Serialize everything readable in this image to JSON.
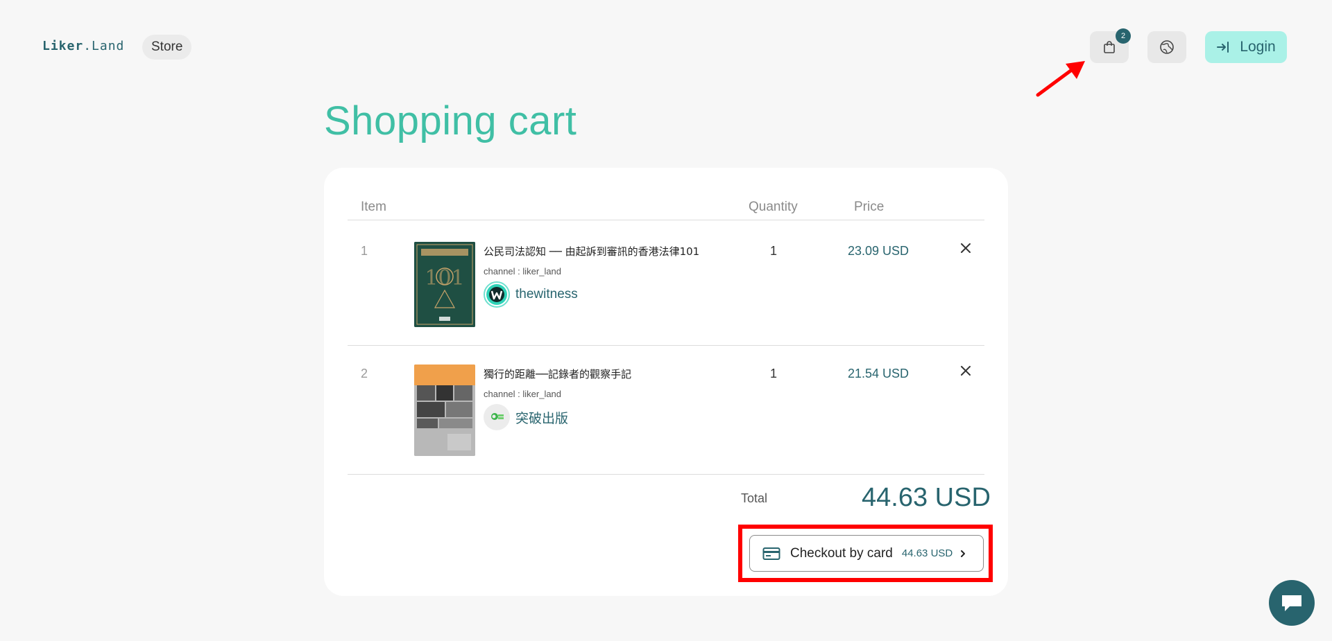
{
  "header": {
    "logo_main": "Liker",
    "logo_dot": ".",
    "logo_sub": "Land",
    "store_label": "Store",
    "cart_count": "2",
    "login_label": "Login"
  },
  "main": {
    "title": "Shopping cart"
  },
  "table": {
    "headers": {
      "item": "Item",
      "quantity": "Quantity",
      "price": "Price"
    },
    "rows": [
      {
        "index": "1",
        "title": "公民司法認知 ── 由起訴到審訊的香港法律101",
        "channel": "channel : liker_land",
        "author": "thewitness",
        "quantity": "1",
        "price": "23.09 USD"
      },
      {
        "index": "2",
        "title": "獨行的距離──記錄者的觀察手記",
        "channel": "channel : liker_land",
        "author": "突破出版",
        "quantity": "1",
        "price": "21.54 USD"
      }
    ]
  },
  "summary": {
    "total_label": "Total",
    "total_value": "44.63 USD"
  },
  "checkout": {
    "label": "Checkout by card",
    "price": "44.63 USD"
  },
  "colors": {
    "accent": "#40bfa5",
    "brand_dark": "#28646e",
    "login_bg": "#aaf1e7",
    "highlight": "#ff0000"
  },
  "icons": [
    "shopping-bag-icon",
    "globe-icon",
    "login-arrow-icon",
    "close-icon",
    "credit-card-icon",
    "chevron-right-icon",
    "chat-icon"
  ]
}
